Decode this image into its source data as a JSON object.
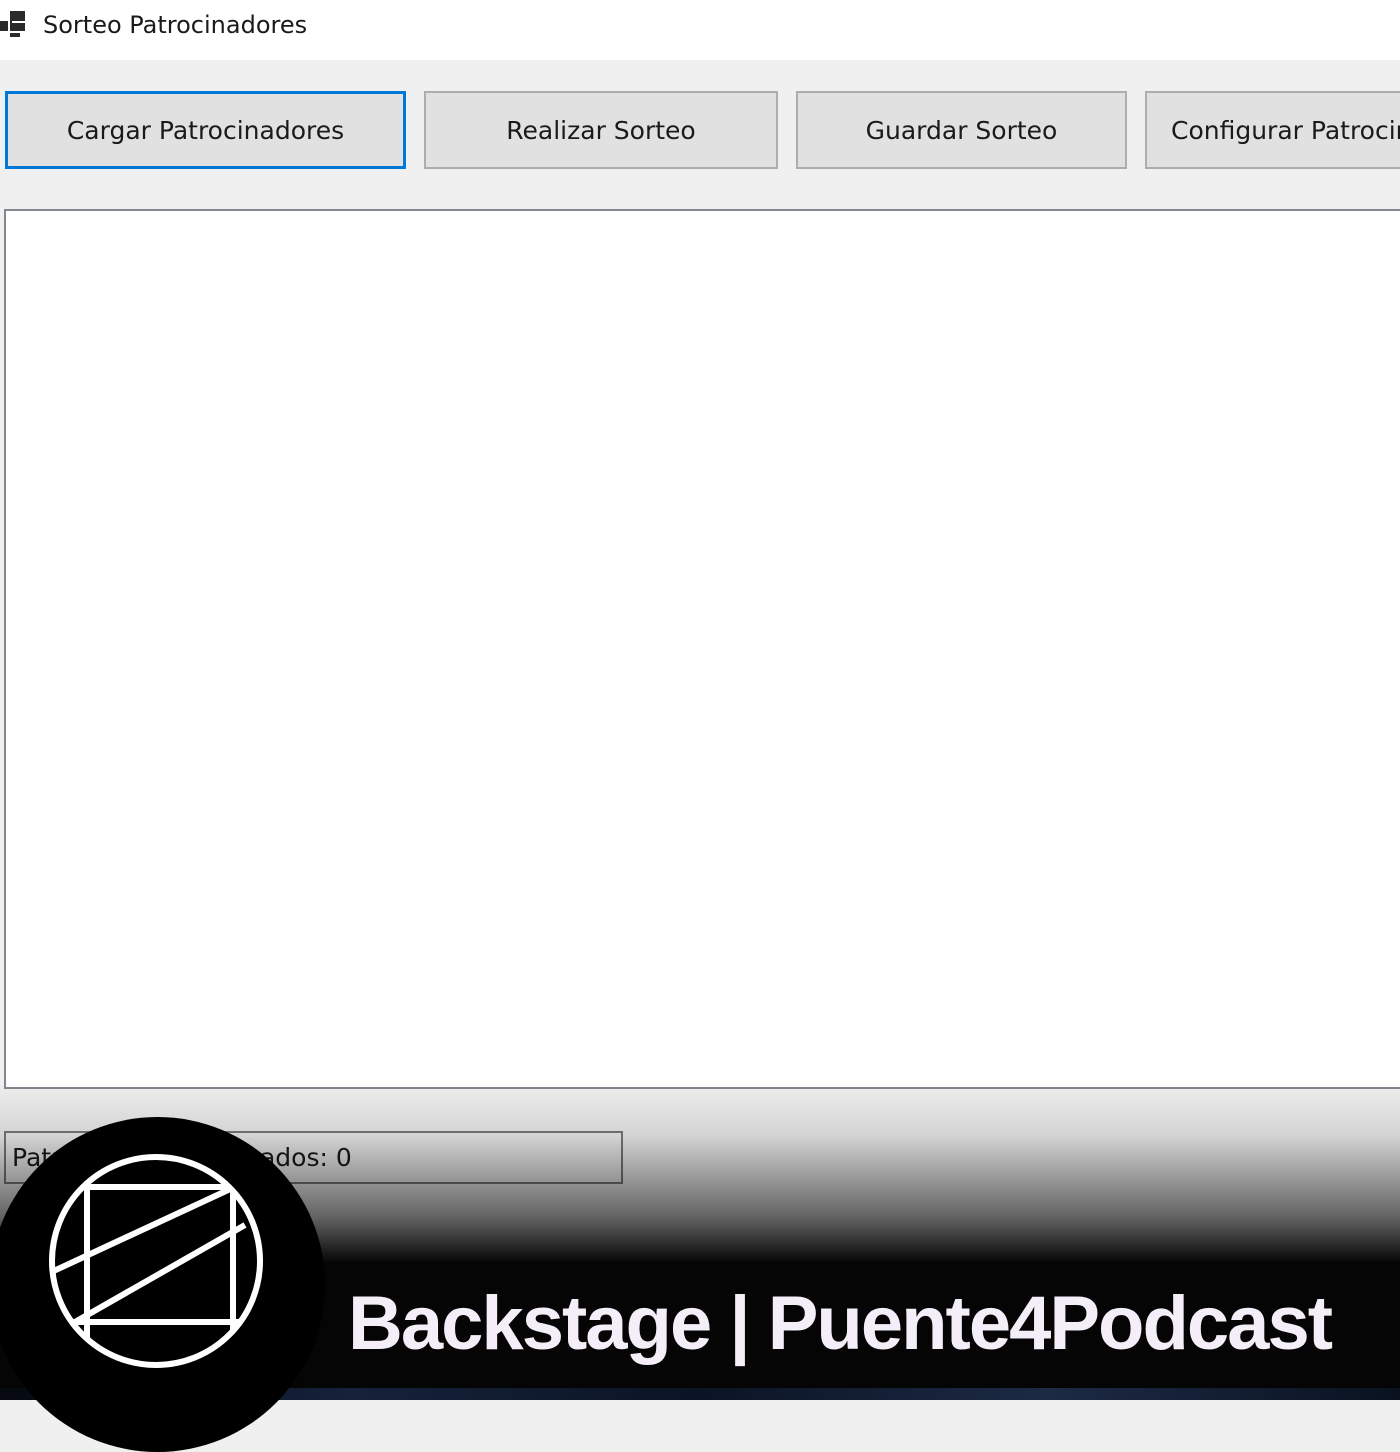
{
  "window": {
    "title": "Sorteo Patrocinadores",
    "icon": "app-window-icon"
  },
  "toolbar": {
    "load_label": "Cargar Patrocinadores",
    "draw_label": "Realizar Sorteo",
    "save_label": "Guardar Sorteo",
    "config_label": "Configurar Patrocinadores"
  },
  "list": {
    "items": []
  },
  "status": {
    "text": "Patrocinadores cargados: 0",
    "visible_start": "Pat",
    "visible_end": "ados: 0"
  },
  "banner": {
    "title": "Backstage | Puente4Podcast",
    "logo": "puente4podcast-logo"
  },
  "colors": {
    "focus_border": "#0078d7",
    "button_face": "#e1e1e1",
    "window_bg": "#f0f0f0",
    "banner_bg": "#050505",
    "banner_text": "#f4eef8"
  }
}
